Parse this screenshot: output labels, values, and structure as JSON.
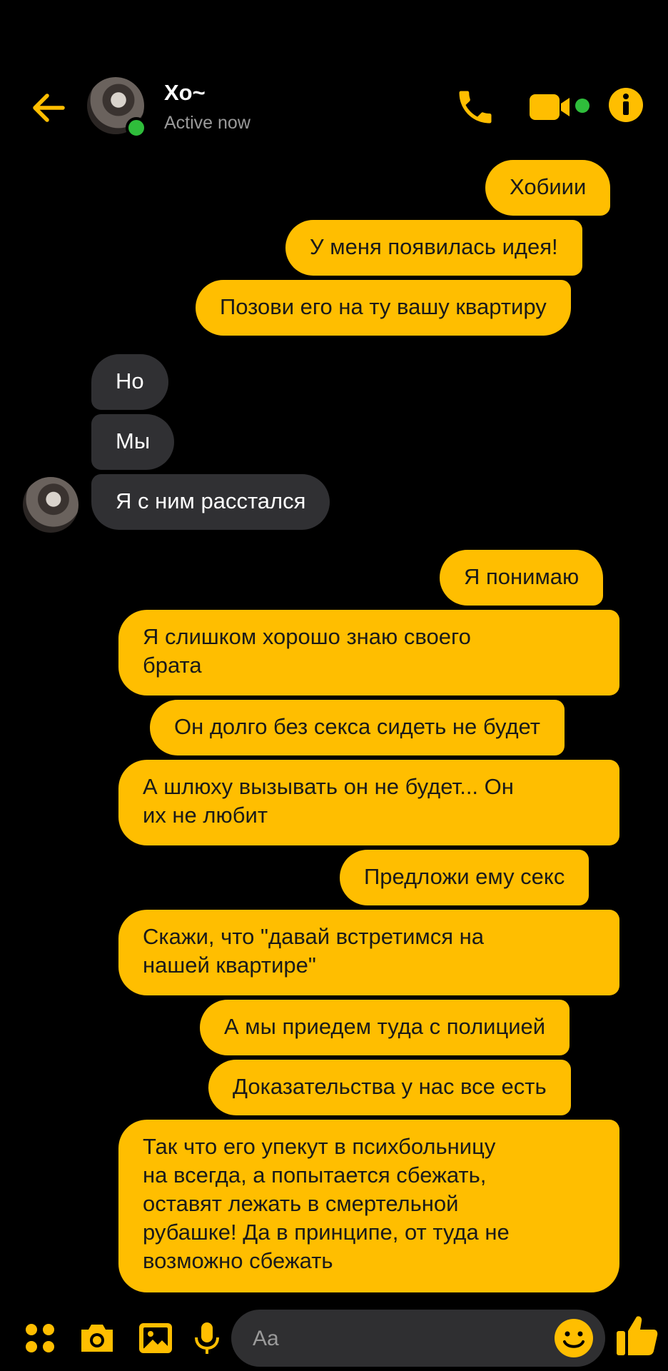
{
  "header": {
    "back_icon": "arrow-left-icon",
    "title": "Xo~",
    "status": "Active now",
    "actions": [
      "phone-icon",
      "video-camera-icon",
      "info-icon"
    ]
  },
  "messages": [
    {
      "side": "out",
      "text": "Хобиии"
    },
    {
      "side": "out",
      "text": "У меня появилась идея!"
    },
    {
      "side": "out",
      "text": "Позови его на ту вашу квартиру"
    },
    {
      "side": "in",
      "text": "Но"
    },
    {
      "side": "in",
      "text": "Мы"
    },
    {
      "side": "in",
      "text": "Я с ним расстался"
    },
    {
      "side": "out",
      "text": "Я понимаю"
    },
    {
      "side": "out",
      "text": "Я слишком хорошо знаю своего\nбрата"
    },
    {
      "side": "out",
      "text": "Он долго без секса сидеть не будет"
    },
    {
      "side": "out",
      "text": "А шлюху вызывать он не будет... Он\nих не любит"
    },
    {
      "side": "out",
      "text": "Предложи ему секс"
    },
    {
      "side": "out",
      "text": "Скажи, что \"давай встретимся на\nнашей квартире\""
    },
    {
      "side": "out",
      "text": "А мы приедем туда с полицией"
    },
    {
      "side": "out",
      "text": "Доказательства у нас все есть"
    },
    {
      "side": "out",
      "text": "Так что его упекут в психбольницу\nна всегда, а попытается сбежать,\nоставят лежать в смертельной\nрубашке! Да в принципе, от туда не\nвозможно сбежать"
    }
  ],
  "composer": {
    "placeholder": "Aa",
    "icons": [
      "apps-grid-icon",
      "camera-icon",
      "gallery-icon",
      "microphone-icon",
      "emoji-icon",
      "thumbs-up-icon"
    ]
  },
  "colors": {
    "accent": "#ffbe00",
    "incoming_bubble": "#303033",
    "online": "#2fbd3b",
    "background": "#000000"
  }
}
